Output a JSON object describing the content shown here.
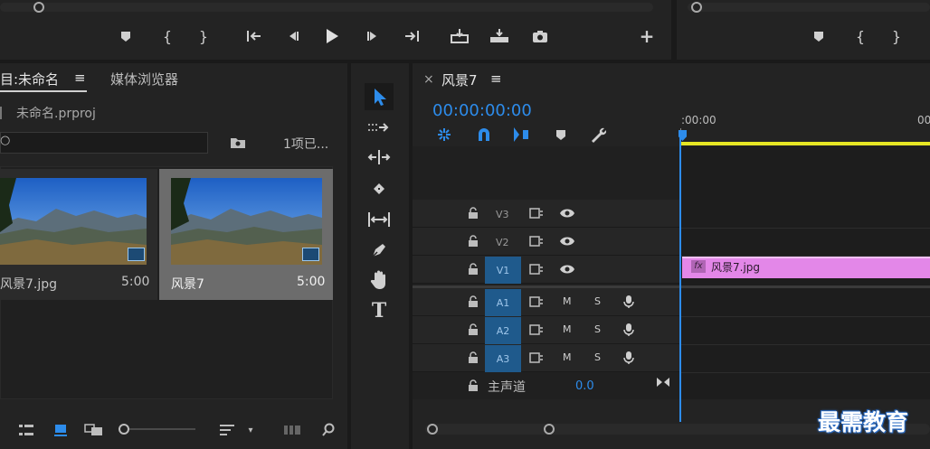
{
  "top_toolbar": {
    "buttons": [
      "add-marker",
      "mark-in",
      "mark-out",
      "go-to-in",
      "step-back",
      "play",
      "step-forward",
      "go-to-out",
      "insert",
      "overwrite",
      "export-frame",
      "add"
    ]
  },
  "project_panel": {
    "tab_label": "目:未命名",
    "tab2_label": "媒体浏览器",
    "project_file": "未命名.prproj",
    "search_placeholder": "",
    "item_count": "1项已...",
    "items": [
      {
        "name": "风景7.jpg",
        "duration": "5:00"
      },
      {
        "name": "风景7",
        "duration": "5:00"
      }
    ]
  },
  "timeline_panel": {
    "sequence_name": "风景7",
    "timecode": "00:00:00:00",
    "ruler_labels": [
      ":00:00",
      "00"
    ],
    "video_tracks": [
      "V3",
      "V2",
      "V1"
    ],
    "audio_tracks": [
      "A1",
      "A2",
      "A3"
    ],
    "audio_track_flags": {
      "mute": "M",
      "solo": "S"
    },
    "master_label": "主声道",
    "master_value": "0.0",
    "clip": {
      "fx": "fx",
      "name": "风景7.jpg",
      "color": "#e387e8"
    }
  },
  "watermark": "最需教育",
  "colors": {
    "accent": "#2d8ceb",
    "playhead": "#2d8ceb",
    "work_area": "#e6e624",
    "track_target": "#1f5a8c"
  }
}
